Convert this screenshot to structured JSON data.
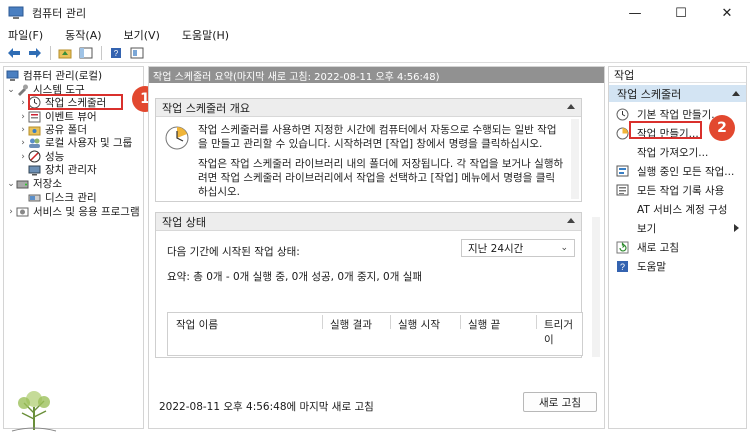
{
  "window": {
    "title": "컴퓨터 관리",
    "minimize_glyph": "—",
    "maximize_glyph": "☐",
    "close_glyph": "✕"
  },
  "menu": [
    "파일(F)",
    "동작(A)",
    "보기(V)",
    "도움말(H)"
  ],
  "tree": {
    "root": "컴퓨터 관리(로컬)",
    "system_tools": "시스템 도구",
    "task_scheduler": "작업 스케줄러",
    "event_viewer": "이벤트 뷰어",
    "shared_folders": "공유 폴더",
    "local_users": "로컬 사용자 및 그룹",
    "performance": "성능",
    "device_manager": "장치 관리자",
    "storage": "저장소",
    "disk_management": "디스크 관리",
    "services": "서비스 및 응용 프로그램"
  },
  "center": {
    "header": "작업 스케줄러 요약(마지막 새로 고침: 2022-08-11 오후 4:56:48)",
    "overview": {
      "title": "작업 스케줄러 개요",
      "para1": "작업 스케줄러를 사용하면 지정한 시간에 컴퓨터에서 자동으로 수행되는 일반 작업을 만들고 관리할 수 있습니다. 시작하려면 [작업] 창에서 명령을 클릭하십시오.",
      "para2": "작업은 작업 스케줄러 라이브러리 내의 폴더에 저장됩니다. 각 작업을 보거나 실행하려면 작업 스케줄러 라이브러리에서 작업을 선택하고 [작업] 메뉴에서 명령을 클릭하십시오."
    },
    "status": {
      "title": "작업 상태",
      "period_label": "다음 기간에 시작된 작업 상태:",
      "period_value": "지난 24시간",
      "summary": "요약: 총 0개 - 0개 실행 중, 0개 성공, 0개 중지, 0개 실패",
      "columns": [
        "작업 이름",
        "실행 결과",
        "실행 시작",
        "실행 끝",
        "트리거 이"
      ]
    },
    "footer": "2022-08-11 오후 4:56:48에 마지막 새로 고침",
    "refresh_label": "새로 고침"
  },
  "actions": {
    "title": "작업",
    "group": "작업 스케줄러",
    "items": [
      "기본 작업 만들기...",
      "작업 만들기...",
      "작업 가져오기...",
      "실행 중인 모든 작업...",
      "모든 작업 기록 사용",
      "AT 서비스 계정 구성",
      "보기",
      "새로 고침",
      "도움말"
    ]
  },
  "callouts": [
    "1",
    "2"
  ],
  "colors": {
    "highlight": "#d9302c",
    "badge": "#e2482f",
    "actions_group_bg": "#d3e4f3",
    "center_header_bg": "#919191"
  }
}
